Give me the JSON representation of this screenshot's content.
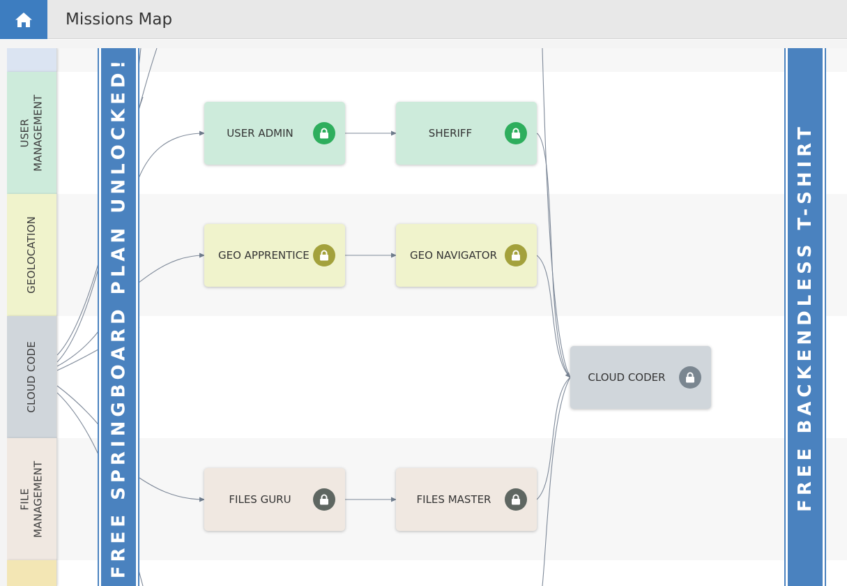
{
  "header": {
    "title": "Missions Map",
    "home_icon": "home-icon"
  },
  "categories": [
    {
      "key": "user-management",
      "label": "USER\nMANAGEMENT",
      "color": "#cdebdb"
    },
    {
      "key": "geolocation",
      "label": "GEOLOCATION",
      "color": "#f0f3cc"
    },
    {
      "key": "cloud-code",
      "label": "CLOUD CODE",
      "color": "#d0d6db"
    },
    {
      "key": "file-management",
      "label": "FILE\nMANAGEMENT",
      "color": "#f0e8e1"
    }
  ],
  "banners": {
    "left": {
      "label": "FREE SPRINGBOARD PLAN UNLOCKED!",
      "color": "#4a82bf"
    },
    "right": {
      "label": "FREE BACKENDLESS T-SHIRT",
      "color": "#4a82bf"
    }
  },
  "missions": {
    "user_admin": {
      "label": "USER ADMIN",
      "status": "locked",
      "bg": "#cdebdb",
      "lock_color": "#2eae5d"
    },
    "sheriff": {
      "label": "SHERIFF",
      "status": "locked",
      "bg": "#cdebdb",
      "lock_color": "#2eae5d"
    },
    "geo_apprentice": {
      "label": "GEO APPRENTICE",
      "status": "locked",
      "bg": "#f0f3cc",
      "lock_color": "#a3a13c"
    },
    "geo_navigator": {
      "label": "GEO NAVIGATOR",
      "status": "locked",
      "bg": "#f0f3cc",
      "lock_color": "#a3a13c"
    },
    "cloud_coder": {
      "label": "CLOUD CODER",
      "status": "locked",
      "bg": "#d0d6db",
      "lock_color": "#7a8690"
    },
    "files_guru": {
      "label": "FILES GURU",
      "status": "locked",
      "bg": "#f0e8e1",
      "lock_color": "#5e6661"
    },
    "files_master": {
      "label": "FILES MASTER",
      "status": "locked",
      "bg": "#f0e8e1",
      "lock_color": "#5e6661"
    }
  },
  "colors": {
    "accent": "#3d7dc0",
    "edge": "#6f7c8c"
  }
}
